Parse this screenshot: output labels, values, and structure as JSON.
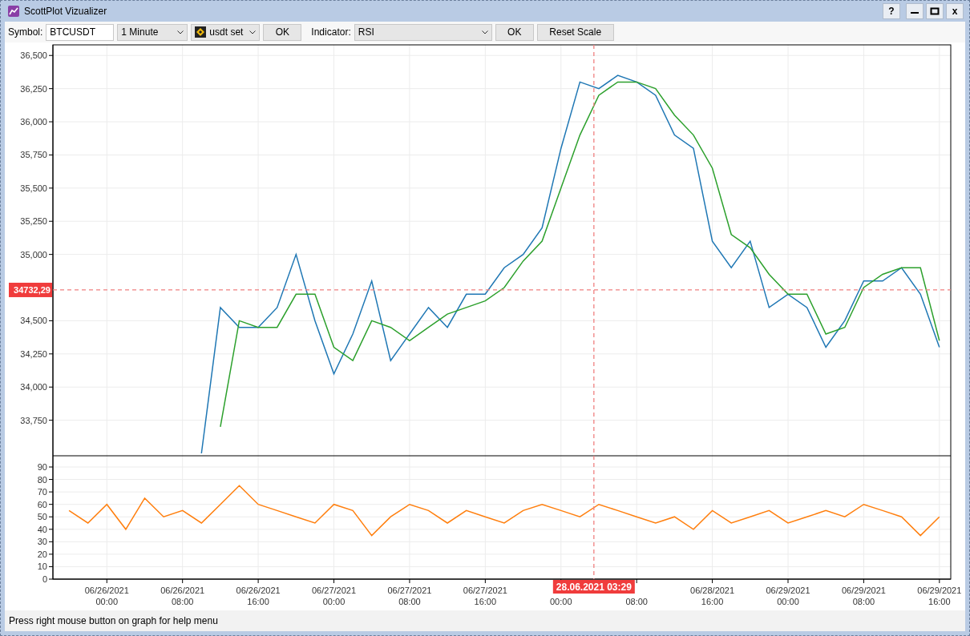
{
  "window": {
    "title": "ScottPlot Vizualizer",
    "help_button": "?",
    "close_button": "x"
  },
  "toolbar": {
    "symbol_label": "Symbol:",
    "symbol_value": "BTCUSDT",
    "interval": "1 Minute",
    "preset": "usdt set",
    "preset_ok": "OK",
    "indicator_label": "Indicator:",
    "indicator": "RSI",
    "indicator_ok": "OK",
    "reset_button": "Reset Scale"
  },
  "price_chart": {
    "chart_data": {
      "type": "line",
      "categories": [
        null,
        null,
        null,
        null,
        null,
        null,
        null,
        null,
        null,
        null,
        null,
        null,
        null,
        null,
        null,
        null,
        null,
        null,
        null,
        null,
        null,
        null,
        null,
        null,
        null,
        null,
        null,
        null,
        null,
        null,
        null,
        null,
        null,
        null,
        null,
        null,
        null,
        null,
        null,
        null,
        null,
        null,
        null,
        null,
        null,
        null,
        null
      ],
      "series": [
        {
          "color": "#1f77b4",
          "values": [
            null,
            null,
            null,
            null,
            null,
            null,
            null,
            33500,
            34600,
            34450,
            34450,
            34600,
            35000,
            34500,
            34100,
            34400,
            34800,
            34200,
            34400,
            34600,
            34450,
            34700,
            34700,
            34900,
            35000,
            35200,
            35800,
            36300,
            36250,
            36350,
            36300,
            36200,
            35900,
            35800,
            35100,
            34900,
            35100,
            34600,
            34700,
            34600,
            34300,
            34500,
            34800,
            34800,
            34900,
            34700,
            34300
          ]
        },
        {
          "color": "#2ca02c",
          "values": [
            null,
            null,
            null,
            null,
            null,
            null,
            null,
            null,
            33700,
            34500,
            34450,
            34450,
            34700,
            34700,
            34300,
            34200,
            34500,
            34450,
            34350,
            34450,
            34550,
            34600,
            34650,
            34750,
            34950,
            35100,
            35500,
            35900,
            36200,
            36300,
            36300,
            36250,
            36050,
            35900,
            35650,
            35150,
            35050,
            34850,
            34700,
            34700,
            34400,
            34450,
            34750,
            34850,
            34900,
            34900,
            34350
          ]
        }
      ],
      "ylim": [
        33482,
        36580
      ],
      "grid": true,
      "ref_lines": [
        {
          "axis": "y",
          "value": 34732.29
        }
      ],
      "yticks": [
        {
          "value": 33750,
          "label": "33,750"
        },
        {
          "value": 34000,
          "label": "34,000"
        },
        {
          "value": 34250,
          "label": "34,250"
        },
        {
          "value": 34500,
          "label": "34,500"
        },
        {
          "value": 35000,
          "label": "35,000"
        },
        {
          "value": 35250,
          "label": "35,250"
        },
        {
          "value": 35500,
          "label": "35,500"
        },
        {
          "value": 35750,
          "label": "35,750"
        },
        {
          "value": 36000,
          "label": "36,000"
        },
        {
          "value": 36250,
          "label": "36,250"
        },
        {
          "value": 36500,
          "label": "36,500"
        }
      ],
      "annotations": [
        "34732,29"
      ]
    }
  },
  "indicator_chart": {
    "chart_data": {
      "type": "line",
      "categories": [
        null,
        null,
        "06/26/2021 00:00",
        null,
        null,
        null,
        "06/26/2021 08:00",
        null,
        null,
        null,
        "06/26/2021 16:00",
        null,
        null,
        null,
        "06/27/2021 00:00",
        null,
        null,
        null,
        "06/27/2021 08:00",
        null,
        null,
        null,
        "06/27/2021 16:00",
        null,
        null,
        null,
        "00:00",
        null,
        null,
        null,
        "08:00",
        null,
        null,
        null,
        "06/28/2021 16:00",
        null,
        null,
        null,
        "06/29/2021 00:00",
        null,
        null,
        null,
        "06/29/2021 08:00",
        null,
        null,
        null,
        "06/29/2021 16:00"
      ],
      "series": [
        {
          "color": "#ff7f0e",
          "values": [
            55,
            45,
            60,
            40,
            65,
            50,
            55,
            45,
            60,
            75,
            60,
            55,
            50,
            45,
            60,
            55,
            35,
            50,
            60,
            55,
            45,
            55,
            50,
            45,
            55,
            60,
            55,
            50,
            60,
            55,
            50,
            45,
            50,
            40,
            55,
            45,
            50,
            55,
            45,
            50,
            55,
            50,
            60,
            55,
            50,
            35,
            50
          ]
        }
      ],
      "ylim": [
        0,
        99
      ],
      "grid": true,
      "yticks": [
        0,
        10,
        20,
        30,
        40,
        50,
        60,
        70,
        80,
        90
      ],
      "annotations": [
        "28.06.2021 03:29"
      ]
    }
  },
  "status_bar": "Press right mouse button on graph for help menu"
}
